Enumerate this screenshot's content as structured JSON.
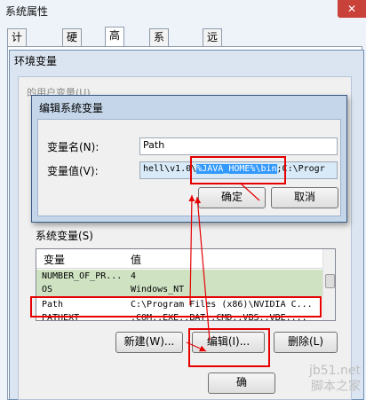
{
  "system_window": {
    "title": "系统属性",
    "close_glyph": "✕",
    "tabs": [
      "计算机名",
      "硬件",
      "高级",
      "系统保护",
      "远程"
    ]
  },
  "env_dialog": {
    "title": "环境变量",
    "ghost_user_vars": "的用户变量(U)",
    "system_vars_label": "系统变量(S)",
    "columns": [
      "变量",
      "值"
    ],
    "rows": [
      {
        "name": "NUMBER_OF_PR...",
        "value": "4"
      },
      {
        "name": "OS",
        "value": "Windows_NT"
      },
      {
        "name": "Path",
        "value": "C:\\Program Files (x86)\\NVIDIA C..."
      },
      {
        "name": "PATHEXT",
        "value": ".COM;.EXE;.BAT;.CMD;.VBS;.VBE;..."
      }
    ],
    "new_button": "新建(W)...",
    "edit_button": "编辑(I)...",
    "delete_button": "删除(L)",
    "ok_partial": "确"
  },
  "edit_dialog": {
    "title": "编辑系统变量",
    "name_label": "变量名(N):",
    "name_value": "Path",
    "value_label": "变量值(V):",
    "value_prefix": "hell\\v1.0\\",
    "value_highlight": "%JAVA_HOME%\\bin",
    "value_suffix": ";C:\\Progr",
    "ok_button": "确定",
    "cancel_button": "取消"
  },
  "watermark": {
    "line1": "jb51.net",
    "line2": "脚本之家"
  },
  "colors": {
    "highlight_row": "#cfe3c3",
    "annotation_red": "#e60000",
    "selection_blue": "#3399ff"
  }
}
